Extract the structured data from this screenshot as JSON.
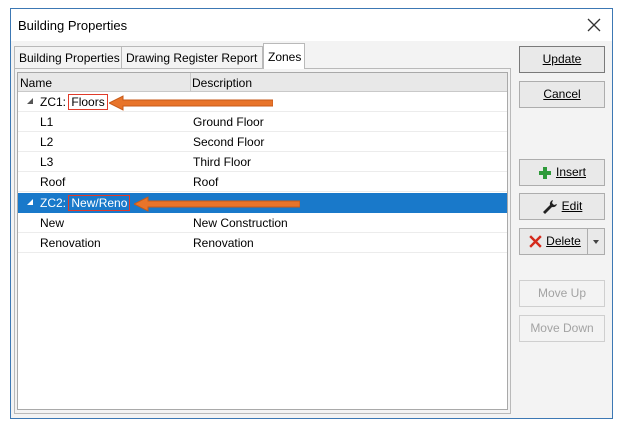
{
  "window": {
    "title": "Building Properties"
  },
  "tabs": [
    {
      "label": "Building Properties",
      "active": false
    },
    {
      "label": "Drawing Register Report",
      "active": false
    },
    {
      "label": "Zones",
      "active": true
    }
  ],
  "grid": {
    "columns": [
      "Name",
      "Description"
    ],
    "rows": [
      {
        "prefix": "ZC1:",
        "name": "Floors",
        "description": "",
        "group": true,
        "selected": false
      },
      {
        "name": "L1",
        "description": "Ground Floor"
      },
      {
        "name": "L2",
        "description": "Second Floor"
      },
      {
        "name": "L3",
        "description": "Third Floor"
      },
      {
        "name": "Roof",
        "description": "Roof"
      },
      {
        "prefix": "ZC2:",
        "name": "New/Reno",
        "description": "",
        "group": true,
        "selected": true
      },
      {
        "name": "New",
        "description": "New Construction"
      },
      {
        "name": "Renovation",
        "description": "Renovation"
      }
    ]
  },
  "buttons": {
    "update": "Update",
    "cancel": "Cancel",
    "insert": "Insert",
    "edit": "Edit",
    "delete": "Delete",
    "move_up": "Move Up",
    "move_down": "Move Down"
  },
  "colors": {
    "selection": "#1979ca",
    "annotation": "#e8742a",
    "highlight_box": "#e03b2a"
  },
  "icons": {
    "close": "close-icon",
    "insert": "plus-icon",
    "edit": "wrench-icon",
    "delete": "x-icon"
  }
}
